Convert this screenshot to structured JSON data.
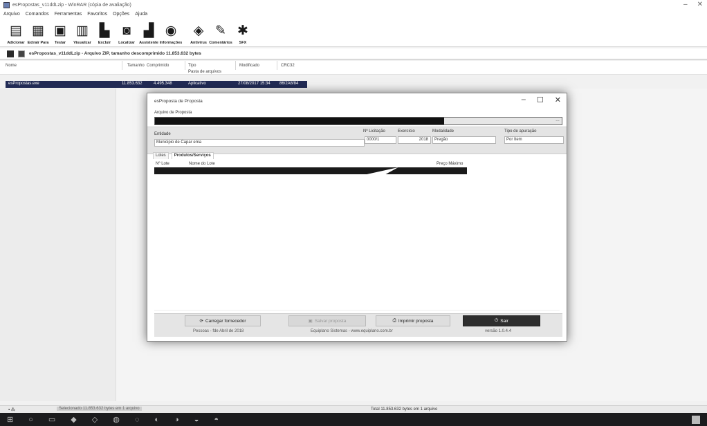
{
  "window": {
    "title": "esPropostas_v11ddLzip - WinRAR (cópia de avaliação)",
    "controls": [
      "–",
      "✕"
    ]
  },
  "menu": [
    "Arquivo",
    "Comandos",
    "Ferramentas",
    "Favoritos",
    "Opções",
    "Ajuda"
  ],
  "toolbar": [
    {
      "label": "Adicionar",
      "icon": "books-icon"
    },
    {
      "label": "Extrair Para",
      "icon": "extract-icon"
    },
    {
      "label": "Testar",
      "icon": "test-icon"
    },
    {
      "label": "Visualizar",
      "icon": "view-icon"
    },
    {
      "label": "Excluir",
      "icon": "delete-icon"
    },
    {
      "label": "Localizar",
      "icon": "find-icon"
    },
    {
      "label": "Assistente",
      "icon": "wizard-icon"
    },
    {
      "label": "Informações",
      "icon": "info-icon"
    },
    {
      "label": "Antivírus",
      "icon": "antivirus-icon"
    },
    {
      "label": "Comentários",
      "icon": "comment-icon"
    },
    {
      "label": "SFX",
      "icon": "sfx-icon"
    }
  ],
  "address": "esPropostas_v11ddLzip - Arquivo ZIP, tamanho descomprimido 11.853.632 bytes",
  "list": {
    "columns": {
      "name": "Nome",
      "size": "Tamanho",
      "packed": "Comprimido",
      "type": "Tipo",
      "modified": "Modificado",
      "crc": "CRC32"
    },
    "folder_row": "Pasta de arquivos",
    "files": [
      {
        "name": "esPropostas.exe",
        "size": "11.853.632",
        "packed": "4.495.348",
        "type": "Aplicativo",
        "modified": "27/08/2017 15:34",
        "crc": "86/2A8/84"
      }
    ]
  },
  "status": {
    "left": "Selecionado 11.853.632 bytes em 1 arquivo",
    "right": "Total 11.853.632 bytes em 1 arquivo"
  },
  "dialog": {
    "title": "esProposta de Proposta",
    "controls": [
      "–",
      "☐",
      "✕"
    ],
    "file_label": "Arquivo de Proposta",
    "entidade_label": "Entidade",
    "entidade_value": "Municipio de Capar ema",
    "licitacao_label": "Nº Licitação",
    "licitacao_value": "0000/1",
    "exercicio_label": "Exercício",
    "exercicio_value": "2018",
    "modalidade_label": "Modalidade",
    "modalidade_value": "Pregão",
    "tipo_label": "Tipo de apuração",
    "tipo_value": "Por Item",
    "tabs": [
      "Lotes",
      "Produtos/Serviços"
    ],
    "grid": {
      "col_lote": "Nº Lote",
      "col_nome": "Nome do Lote",
      "col_preco": "Preço Máximo"
    },
    "buttons": [
      {
        "label": "Carregar fornecedor",
        "icon": "load-icon",
        "enabled": true
      },
      {
        "label": "Salvar proposta",
        "icon": "save-icon",
        "enabled": false
      },
      {
        "label": "Imprimir proposta",
        "icon": "print-icon",
        "enabled": true
      },
      {
        "label": "Sair",
        "icon": "exit-icon",
        "enabled": true
      }
    ],
    "footer": {
      "left": "Pessoas - fde Abril de 2018",
      "center": "Equiplano Sistemas - www.equiplano.com.br",
      "right": "versão 1.0.4.4"
    }
  }
}
